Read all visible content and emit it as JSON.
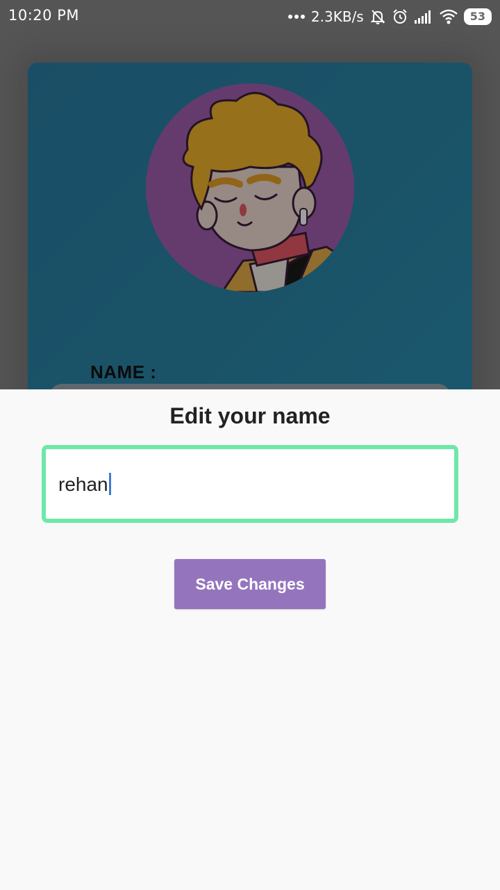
{
  "status_bar": {
    "time": "10:20 PM",
    "more_icon": "more-dots-icon",
    "network_speed": "2.3KB/s",
    "icons": [
      "notifications-off-icon",
      "alarm-icon",
      "signal-icon",
      "wifi-icon"
    ],
    "battery": "53"
  },
  "background": {
    "card_color": "#2a85a8",
    "avatar_icon": "cartoon-avatar",
    "name_label": "NAME :"
  },
  "sheet": {
    "title": "Edit your name",
    "name_value": "rehan",
    "focus_color": "#6ee8a8",
    "save_button_label": "Save Changes",
    "save_button_color": "#9475bd"
  }
}
